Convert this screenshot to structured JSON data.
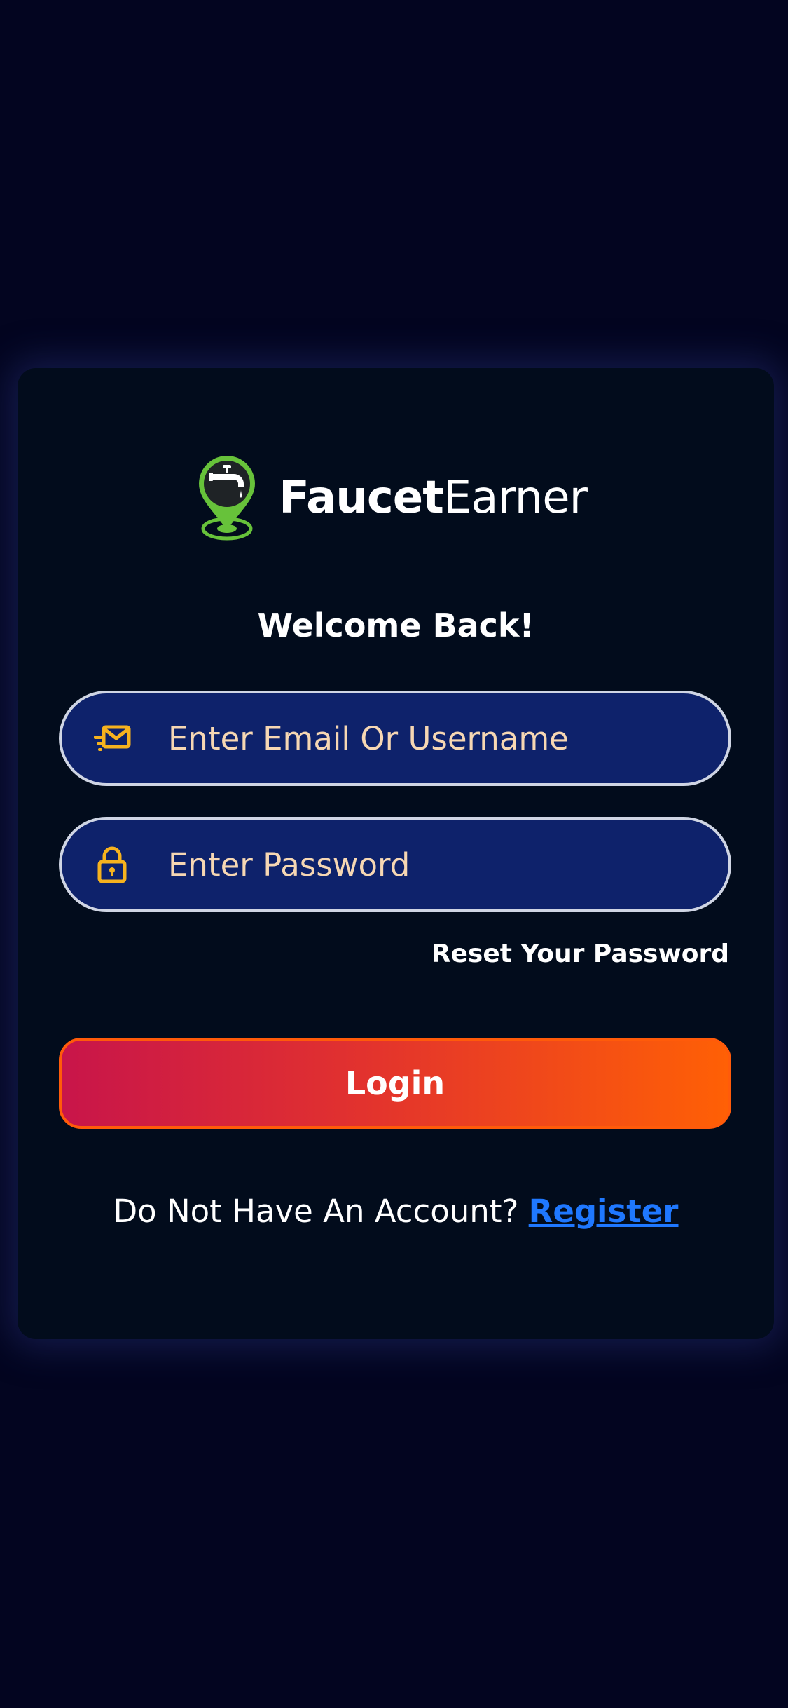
{
  "brand": {
    "name_bold": "Faucet",
    "name_light": "Earner",
    "logo_icon": "faucet-location-pin-icon"
  },
  "welcome": "Welcome Back!",
  "email_field": {
    "placeholder": "Enter Email Or Username",
    "value": "",
    "icon": "envelope-icon"
  },
  "password_field": {
    "placeholder": "Enter Password",
    "value": "",
    "icon": "padlock-icon"
  },
  "reset_link": "Reset Your Password",
  "login_button": "Login",
  "register": {
    "prompt": "Do Not Have An Account?",
    "link": "Register"
  },
  "colors": {
    "background": "#030520",
    "card": "#020c1c",
    "field_bg": "#0e226b",
    "field_border": "#cfd5e4",
    "placeholder_text": "#f6d7b3",
    "icon_accent": "#f6b21e",
    "button_gradient_start": "#c8154a",
    "button_gradient_end": "#ff6005",
    "link": "#1f78ff",
    "logo_green": "#67c23a"
  }
}
